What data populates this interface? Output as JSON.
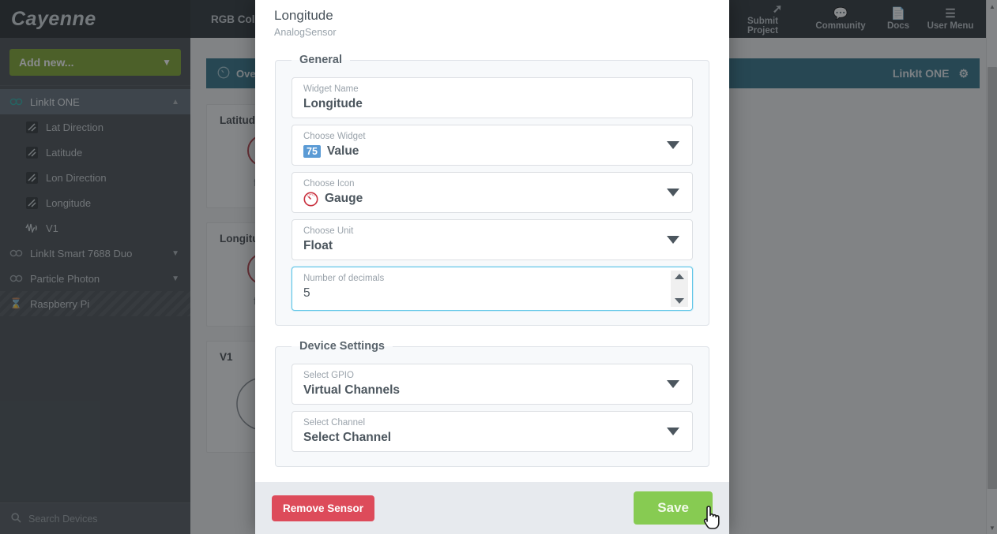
{
  "topbar": {
    "brand": "Cayenne",
    "left_nav": [
      {
        "label": "RGB Colors"
      }
    ],
    "right_nav": [
      {
        "label": "Submit Project",
        "icon": "share-icon"
      },
      {
        "label": "Community",
        "icon": "chat-icon"
      },
      {
        "label": "Docs",
        "icon": "document-icon"
      },
      {
        "label": "User Menu",
        "icon": "hamburger-icon"
      }
    ]
  },
  "sidebar": {
    "add_new_label": "Add new...",
    "search_placeholder": "Search Devices",
    "items": [
      {
        "label": "LinkIt ONE",
        "icon": "arduino-icon",
        "level": "parent",
        "active": true,
        "chevron": "up"
      },
      {
        "label": "Lat Direction",
        "icon": "analog-sensor-icon",
        "level": "child"
      },
      {
        "label": "Latitude",
        "icon": "analog-sensor-icon",
        "level": "child"
      },
      {
        "label": "Lon Direction",
        "icon": "analog-sensor-icon",
        "level": "child"
      },
      {
        "label": "Longitude",
        "icon": "analog-sensor-icon",
        "level": "child"
      },
      {
        "label": "V1",
        "icon": "actuator-icon",
        "level": "child"
      },
      {
        "label": "LinkIt Smart 7688 Duo",
        "icon": "arduino-icon",
        "level": "parent",
        "chevron": "down"
      },
      {
        "label": "Particle Photon",
        "icon": "arduino-icon",
        "level": "parent",
        "chevron": "down"
      },
      {
        "label": "Raspberry Pi",
        "icon": "hourglass-icon",
        "level": "parent",
        "striped": true
      }
    ]
  },
  "content": {
    "tab_label": "Overview",
    "device_name": "LinkIt ONE",
    "gear_icon": "gear-icon",
    "cards": [
      {
        "title": "Latitude",
        "unit": "float"
      },
      {
        "title": "Longitude",
        "unit": "float"
      },
      {
        "title": "V1",
        "unit": ""
      }
    ]
  },
  "modal": {
    "title": "Longitude",
    "subtitle": "AnalogSensor",
    "sections": {
      "general": {
        "legend": "General",
        "fields": [
          {
            "label": "Widget Name",
            "value": "Longitude",
            "type": "text"
          },
          {
            "label": "Choose Widget",
            "value": "Value",
            "badge": "75",
            "type": "select"
          },
          {
            "label": "Choose Icon",
            "value": "Gauge",
            "icon": "gauge-icon",
            "type": "select"
          },
          {
            "label": "Choose Unit",
            "value": "Float",
            "type": "select"
          },
          {
            "label": "Number of decimals",
            "value": "5",
            "type": "number",
            "focused": true
          }
        ]
      },
      "device_settings": {
        "legend": "Device Settings",
        "fields": [
          {
            "label": "Select GPIO",
            "value": "Virtual Channels",
            "type": "select"
          },
          {
            "label": "Select Channel",
            "value": "Select Channel",
            "type": "select"
          }
        ]
      }
    },
    "footer": {
      "remove_label": "Remove Sensor",
      "save_label": "Save"
    }
  },
  "colors": {
    "accent_teal": "#26697f",
    "save_green": "#87cb52",
    "remove_red": "#dd4b5a",
    "badge_blue": "#5b9bd5",
    "gauge_red": "#c9303e",
    "focus_blue": "#63c7e8"
  }
}
